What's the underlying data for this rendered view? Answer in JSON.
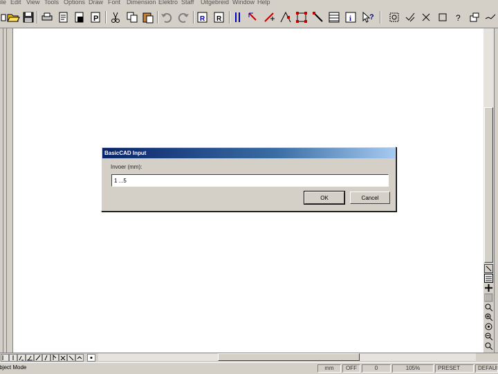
{
  "menu": [
    "ile",
    "Edit",
    "View",
    "Tools",
    "Options",
    "Draw",
    "Font",
    "Dimension",
    "Elektro",
    "Staff",
    "Uitgebreid",
    "Window",
    "Help"
  ],
  "toolbar_icons": [
    "partial-icon",
    "open-folder-icon",
    "save-icon",
    "print-icon",
    "print-preview-icon",
    "page-setup-icon",
    "page-setup-p-icon",
    "cut-icon",
    "copy-icon",
    "paste-icon",
    "undo-icon",
    "redo-icon",
    "properties-r-icon",
    "properties-r2-icon",
    "vertical-bars-icon",
    "arrow-node-icon",
    "node-add-icon",
    "node-move-icon",
    "rectangle-select-icon",
    "line-tool-icon",
    "list-icon",
    "info-icon",
    "help-cursor-icon",
    "zoom-window-icon",
    "zoom-fit-icon",
    "close-x-icon",
    "square-icon",
    "question-icon",
    "layers-icon",
    "checkmark-icon"
  ],
  "dialog": {
    "title": "BasicCAD Input",
    "label": "Invoer (mm):",
    "value": "1 ...5",
    "ok_label": "OK",
    "cancel_label": "Cancel"
  },
  "status": {
    "mode": "Object Mode",
    "units": "mm",
    "snap": "OFF",
    "value": "0",
    "zoom": "105%",
    "preset": "PRESET ",
    "layer": "DEFAULT"
  }
}
